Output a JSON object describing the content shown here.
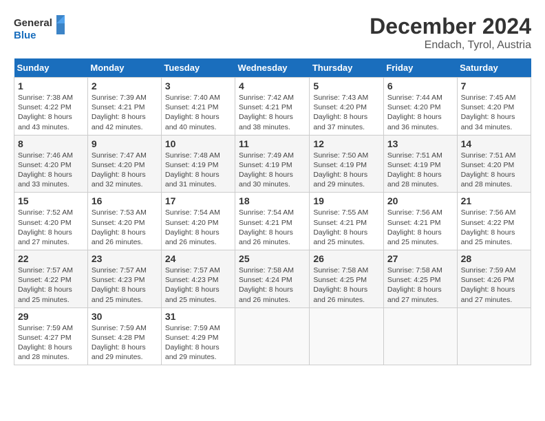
{
  "header": {
    "logo_line1": "General",
    "logo_line2": "Blue",
    "month": "December 2024",
    "location": "Endach, Tyrol, Austria"
  },
  "calendar": {
    "days_of_week": [
      "Sunday",
      "Monday",
      "Tuesday",
      "Wednesday",
      "Thursday",
      "Friday",
      "Saturday"
    ],
    "weeks": [
      [
        {
          "day": "1",
          "info": "Sunrise: 7:38 AM\nSunset: 4:22 PM\nDaylight: 8 hours\nand 43 minutes."
        },
        {
          "day": "2",
          "info": "Sunrise: 7:39 AM\nSunset: 4:21 PM\nDaylight: 8 hours\nand 42 minutes."
        },
        {
          "day": "3",
          "info": "Sunrise: 7:40 AM\nSunset: 4:21 PM\nDaylight: 8 hours\nand 40 minutes."
        },
        {
          "day": "4",
          "info": "Sunrise: 7:42 AM\nSunset: 4:21 PM\nDaylight: 8 hours\nand 38 minutes."
        },
        {
          "day": "5",
          "info": "Sunrise: 7:43 AM\nSunset: 4:20 PM\nDaylight: 8 hours\nand 37 minutes."
        },
        {
          "day": "6",
          "info": "Sunrise: 7:44 AM\nSunset: 4:20 PM\nDaylight: 8 hours\nand 36 minutes."
        },
        {
          "day": "7",
          "info": "Sunrise: 7:45 AM\nSunset: 4:20 PM\nDaylight: 8 hours\nand 34 minutes."
        }
      ],
      [
        {
          "day": "8",
          "info": "Sunrise: 7:46 AM\nSunset: 4:20 PM\nDaylight: 8 hours\nand 33 minutes."
        },
        {
          "day": "9",
          "info": "Sunrise: 7:47 AM\nSunset: 4:20 PM\nDaylight: 8 hours\nand 32 minutes."
        },
        {
          "day": "10",
          "info": "Sunrise: 7:48 AM\nSunset: 4:19 PM\nDaylight: 8 hours\nand 31 minutes."
        },
        {
          "day": "11",
          "info": "Sunrise: 7:49 AM\nSunset: 4:19 PM\nDaylight: 8 hours\nand 30 minutes."
        },
        {
          "day": "12",
          "info": "Sunrise: 7:50 AM\nSunset: 4:19 PM\nDaylight: 8 hours\nand 29 minutes."
        },
        {
          "day": "13",
          "info": "Sunrise: 7:51 AM\nSunset: 4:19 PM\nDaylight: 8 hours\nand 28 minutes."
        },
        {
          "day": "14",
          "info": "Sunrise: 7:51 AM\nSunset: 4:20 PM\nDaylight: 8 hours\nand 28 minutes."
        }
      ],
      [
        {
          "day": "15",
          "info": "Sunrise: 7:52 AM\nSunset: 4:20 PM\nDaylight: 8 hours\nand 27 minutes."
        },
        {
          "day": "16",
          "info": "Sunrise: 7:53 AM\nSunset: 4:20 PM\nDaylight: 8 hours\nand 26 minutes."
        },
        {
          "day": "17",
          "info": "Sunrise: 7:54 AM\nSunset: 4:20 PM\nDaylight: 8 hours\nand 26 minutes."
        },
        {
          "day": "18",
          "info": "Sunrise: 7:54 AM\nSunset: 4:21 PM\nDaylight: 8 hours\nand 26 minutes."
        },
        {
          "day": "19",
          "info": "Sunrise: 7:55 AM\nSunset: 4:21 PM\nDaylight: 8 hours\nand 25 minutes."
        },
        {
          "day": "20",
          "info": "Sunrise: 7:56 AM\nSunset: 4:21 PM\nDaylight: 8 hours\nand 25 minutes."
        },
        {
          "day": "21",
          "info": "Sunrise: 7:56 AM\nSunset: 4:22 PM\nDaylight: 8 hours\nand 25 minutes."
        }
      ],
      [
        {
          "day": "22",
          "info": "Sunrise: 7:57 AM\nSunset: 4:22 PM\nDaylight: 8 hours\nand 25 minutes."
        },
        {
          "day": "23",
          "info": "Sunrise: 7:57 AM\nSunset: 4:23 PM\nDaylight: 8 hours\nand 25 minutes."
        },
        {
          "day": "24",
          "info": "Sunrise: 7:57 AM\nSunset: 4:23 PM\nDaylight: 8 hours\nand 25 minutes."
        },
        {
          "day": "25",
          "info": "Sunrise: 7:58 AM\nSunset: 4:24 PM\nDaylight: 8 hours\nand 26 minutes."
        },
        {
          "day": "26",
          "info": "Sunrise: 7:58 AM\nSunset: 4:25 PM\nDaylight: 8 hours\nand 26 minutes."
        },
        {
          "day": "27",
          "info": "Sunrise: 7:58 AM\nSunset: 4:25 PM\nDaylight: 8 hours\nand 27 minutes."
        },
        {
          "day": "28",
          "info": "Sunrise: 7:59 AM\nSunset: 4:26 PM\nDaylight: 8 hours\nand 27 minutes."
        }
      ],
      [
        {
          "day": "29",
          "info": "Sunrise: 7:59 AM\nSunset: 4:27 PM\nDaylight: 8 hours\nand 28 minutes."
        },
        {
          "day": "30",
          "info": "Sunrise: 7:59 AM\nSunset: 4:28 PM\nDaylight: 8 hours\nand 29 minutes."
        },
        {
          "day": "31",
          "info": "Sunrise: 7:59 AM\nSunset: 4:29 PM\nDaylight: 8 hours\nand 29 minutes."
        },
        {
          "day": "",
          "info": ""
        },
        {
          "day": "",
          "info": ""
        },
        {
          "day": "",
          "info": ""
        },
        {
          "day": "",
          "info": ""
        }
      ]
    ]
  }
}
